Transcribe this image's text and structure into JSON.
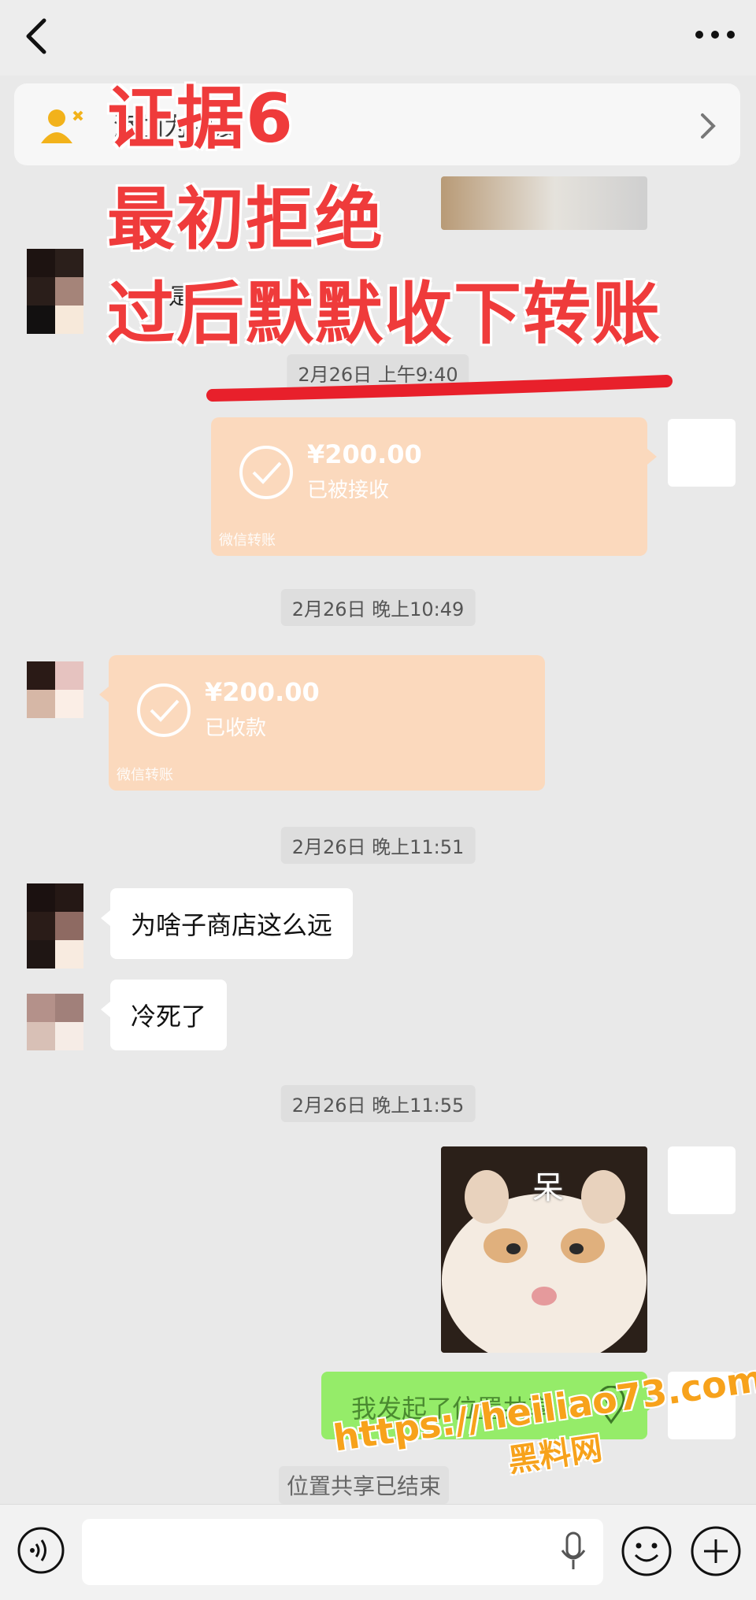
{
  "header": {
    "back_icon": "chevron-left-icon",
    "more_icon": "more-dots-icon"
  },
  "add_friend_bar": {
    "text": "添加为朋友",
    "icon": "add-user-icon"
  },
  "overlay": {
    "line1": "证据6",
    "line2": "最初拒绝",
    "line3": "过后默默收下转账"
  },
  "messages": {
    "partial_text": "是",
    "ts1": "2月26日 上午9:40",
    "transfer_out": {
      "amount": "¥200.00",
      "status": "已被接收",
      "footer": "微信转账"
    },
    "ts2": "2月26日 晚上10:49",
    "transfer_in": {
      "amount": "¥200.00",
      "status": "已收款",
      "footer": "微信转账"
    },
    "ts3": "2月26日 晚上11:51",
    "text1": "为啥子商店这么远",
    "text2": "冷死了",
    "ts4": "2月26日 晚上11:55",
    "sticker_caption": "呆",
    "location_share": "我发起了位置共享",
    "system_notice": "位置共享已结束"
  },
  "input": {
    "voice_icon": "voice-icon",
    "mic_icon": "mic-icon",
    "emoji_icon": "emoji-icon",
    "plus_icon": "plus-icon"
  },
  "watermark": {
    "line1": "https://heiliao73.com",
    "line2": "黑料网"
  },
  "colors": {
    "transfer": "#fbd9bd",
    "outgoing": "#95ec69",
    "overlay_red": "#ef3b3b",
    "watermark": "#f7a21b"
  }
}
